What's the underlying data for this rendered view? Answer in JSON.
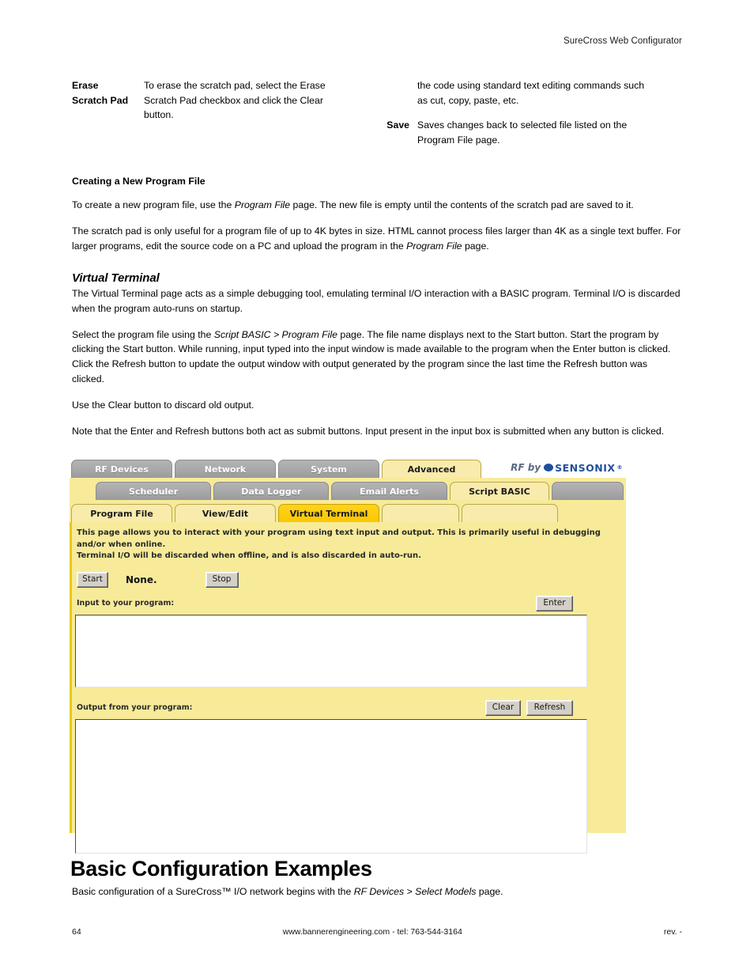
{
  "header": {
    "title": "SureCross Web Configurator"
  },
  "definitions": {
    "left": [
      {
        "term_line1": "Erase",
        "term_line2": "Scratch Pad",
        "description": "To erase the scratch pad, select the Erase Scratch Pad checkbox and click the Clear button."
      }
    ],
    "right": [
      {
        "continuation": "the code using standard text editing commands such as cut, copy, paste, etc."
      },
      {
        "term": "Save",
        "description": "Saves changes back to selected file listed on the Program File page."
      }
    ]
  },
  "creating_section": {
    "heading": "Creating a New Program File",
    "para1_a": "To create a new program file, use the ",
    "para1_italic": "Program File",
    "para1_b": " page. The new file is empty until the contents of the scratch pad are saved to it.",
    "para2_a": "The scratch pad is only useful for a program file of up to 4K bytes in size. HTML cannot process files larger than 4K as a single text buffer. For larger programs, edit the source code on a PC and upload the program in the ",
    "para2_italic": "Program File",
    "para2_b": " page."
  },
  "virtual_terminal_section": {
    "heading": "Virtual Terminal",
    "para1": "The Virtual Terminal page acts as a simple debugging tool, emulating terminal I/O interaction with a BASIC program. Terminal I/O is discarded when the program auto-runs on startup.",
    "para2_a": "Select the program file using the ",
    "para2_italic": "Script BASIC > Program File",
    "para2_b": " page. The file name displays next to the Start button. Start the program by clicking the Start button. While running, input typed into the input window is made available to the program when the Enter button is clicked. Click the Refresh button to update the output window with output generated by the program since the last time the Refresh button was clicked.",
    "para3": "Use the Clear button to discard old output.",
    "para4": "Note that the Enter and Refresh buttons both act as submit buttons. Input present in the input box is submitted when any button is clicked."
  },
  "app_screenshot": {
    "tabs_row1": [
      {
        "label": "RF Devices",
        "state": "inactive"
      },
      {
        "label": "Network",
        "state": "inactive"
      },
      {
        "label": "System",
        "state": "inactive"
      },
      {
        "label": "Advanced",
        "state": "active"
      }
    ],
    "tabs_row2": [
      {
        "label": "Scheduler",
        "state": "inactive"
      },
      {
        "label": "Data Logger",
        "state": "inactive"
      },
      {
        "label": "Email Alerts",
        "state": "inactive"
      },
      {
        "label": "Script BASIC",
        "state": "active"
      },
      {
        "label": "",
        "state": "inactive"
      }
    ],
    "tabs_row3": [
      {
        "label": "Program File",
        "state": "pale"
      },
      {
        "label": "View/Edit",
        "state": "pale"
      },
      {
        "label": "Virtual Terminal",
        "state": "selected"
      },
      {
        "label": "",
        "state": "pale"
      },
      {
        "label": "",
        "state": "pale"
      }
    ],
    "brand": {
      "prefix": "RF by",
      "name": "SENSONIX",
      "registered": "®"
    },
    "intro_line1": "This page allows you to interact with your program using text input and output. This is primarily useful in debugging and/or when online.",
    "intro_line2": "Terminal I/O will be discarded when offline, and is also discarded in auto-run.",
    "start_button": "Start",
    "run_status": "None.",
    "stop_button": "Stop",
    "input_label": "Input to your program:",
    "enter_button": "Enter",
    "input_value": "",
    "output_label": "Output from your program:",
    "clear_button": "Clear",
    "refresh_button": "Refresh",
    "output_value": ""
  },
  "basic_config_section": {
    "heading": "Basic Configuration Examples",
    "sub_a": "Basic configuration of a SureCross™ I/O network begins with the ",
    "sub_italic": "RF Devices > Select Models",
    "sub_b": " page."
  },
  "footer": {
    "page_number": "64",
    "center": "www.bannerengineering.com - tel: 763-544-3164",
    "revision": "rev. -"
  }
}
